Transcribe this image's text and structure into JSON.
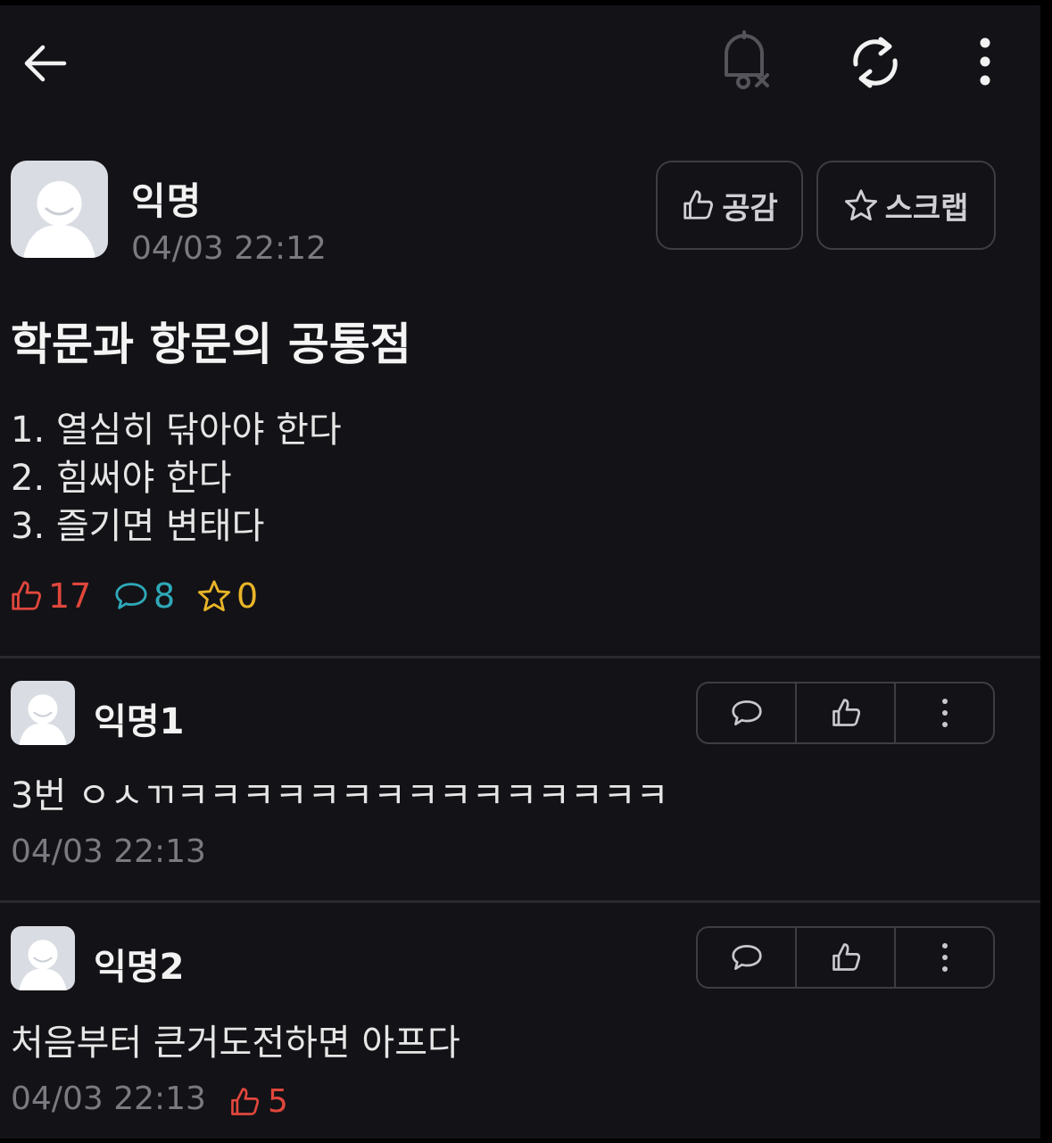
{
  "topbar": {
    "back_icon": "arrow-left-icon",
    "actions": [
      "bell-off-icon",
      "refresh-icon",
      "more-vertical-icon"
    ]
  },
  "post": {
    "author": "익명",
    "time": "04/03 22:12",
    "like_button": "공감",
    "scrap_button": "스크랩",
    "title": "학문과 항문의 공통점",
    "lines": [
      "1. 열심히 닦아야 한다",
      "2. 힘써야 한다",
      "3. 즐기면 변태다"
    ],
    "stats": {
      "likes": "17",
      "comments": "8",
      "scraps": "0"
    },
    "colors": {
      "like": "#e0473c",
      "comment": "#2ea8b8",
      "scrap": "#e8b428"
    }
  },
  "comments": [
    {
      "author": "익명1",
      "text": "3번 ㅇㅅㄲㅋㅋㅋㅋㅋㅋㅋㅋㅋㅋㅋㅋㅋㅋㅋ",
      "time": "04/03 22:13",
      "likes": ""
    },
    {
      "author": "익명2",
      "text": "처음부터 큰거도전하면 아프다",
      "time": "04/03 22:13",
      "likes": "5"
    }
  ]
}
